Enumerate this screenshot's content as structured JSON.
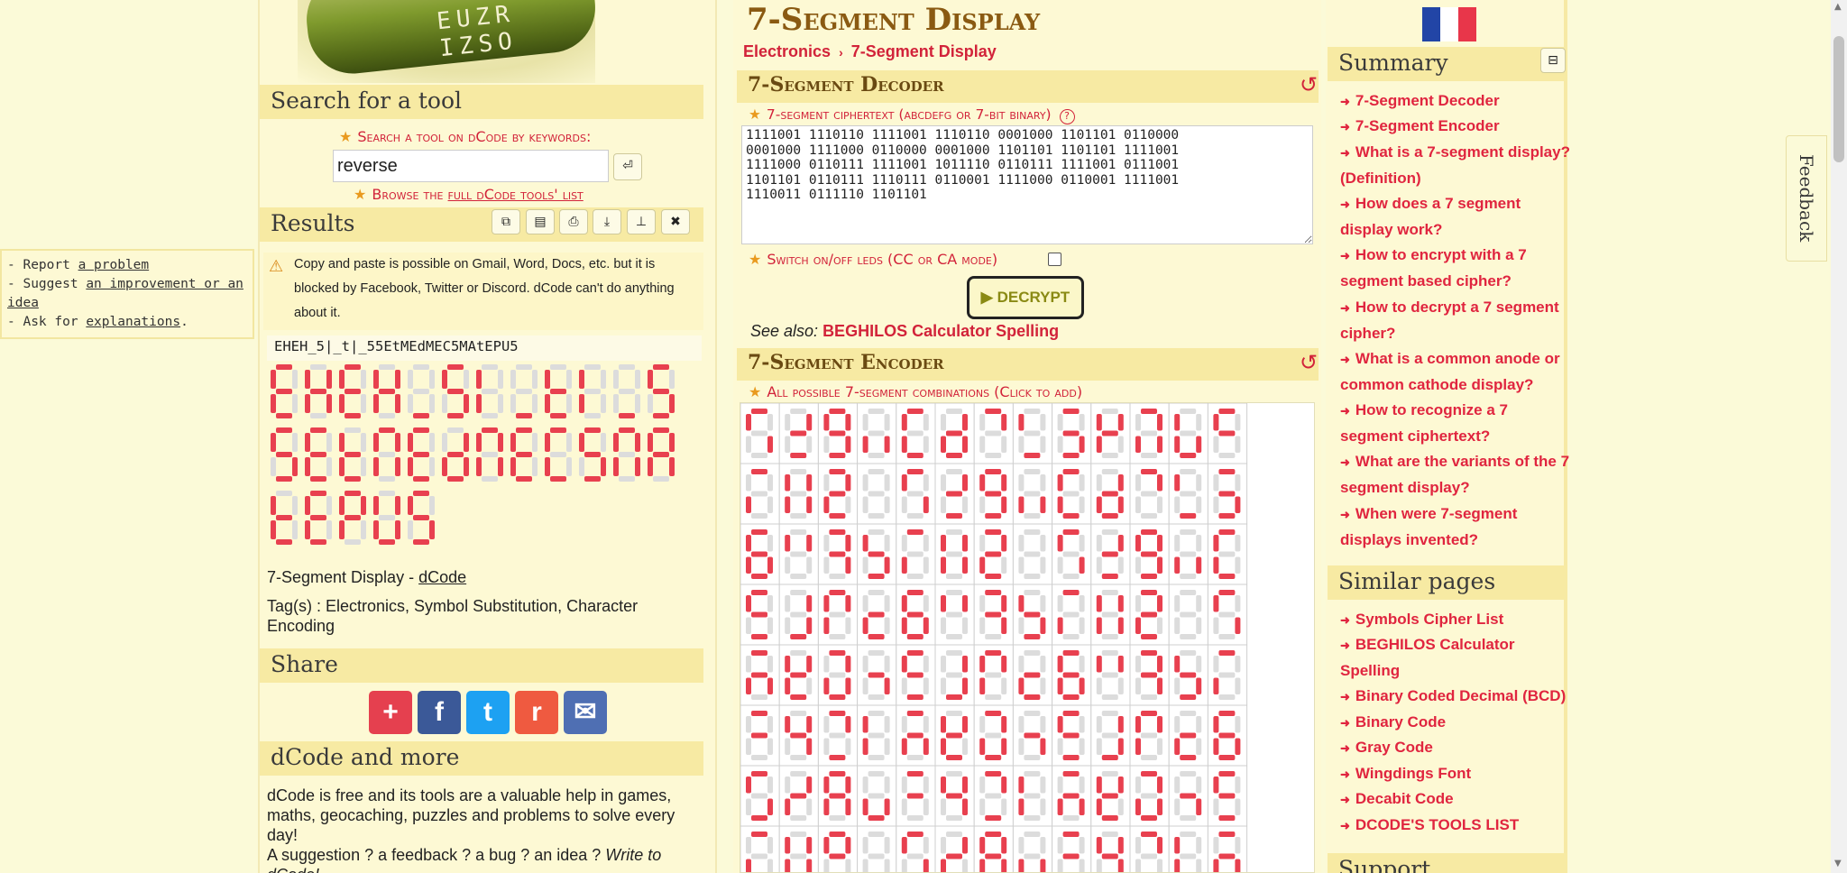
{
  "banner": {
    "letters": "EUZR IZSO"
  },
  "page": {
    "title": "7-Segment Display",
    "flag": "french-flag"
  },
  "breadcrumb": {
    "items": [
      "Electronics",
      "7-Segment Display"
    ],
    "sep": "›"
  },
  "search": {
    "title": "Search for a tool",
    "label": "Search a tool on dCode by keywords:",
    "value": "reverse",
    "enter_icon": "⏎",
    "browse_prefix": "Browse the ",
    "browse_link": "full dCode tools' list"
  },
  "results": {
    "title": "Results",
    "toolbar": [
      "copy-icon",
      "save-icon",
      "print-icon",
      "download-icon",
      "pin-icon",
      "close-icon"
    ],
    "warning": "Copy and paste is possible on Gmail, Word, Docs, etc. but it is blocked by Facebook, Twitter or Discord. dCode can't do anything about it.",
    "text": "EHEH_5|_t|_55EtMEdMEC5MAtEPU5",
    "display_rows": [
      [
        "E",
        "H",
        "E",
        "H",
        "_",
        "5",
        "I",
        "_",
        "t",
        "I",
        "_",
        "5"
      ],
      [
        "5",
        "E",
        "t",
        "M",
        "E",
        "d",
        "M",
        "E",
        "C",
        "5",
        "M",
        "A"
      ],
      [
        "t",
        "E",
        "P",
        "U",
        "5"
      ]
    ],
    "attribution_text": "7-Segment Display - ",
    "attribution_link": "dCode",
    "tags": "Tag(s) : Electronics, Symbol Substitution, Character Encoding"
  },
  "report": {
    "line1_prefix": "- Report ",
    "line1_link": "a problem",
    "line2_prefix": "- Suggest ",
    "line2_link": "an improvement or an idea",
    "line3_prefix": "- Ask for ",
    "line3_link": "explanations",
    "line3_suffix": "."
  },
  "share": {
    "title": "Share",
    "buttons": [
      {
        "icon": "plus-icon",
        "glyph": "+",
        "color": "#e5404f"
      },
      {
        "icon": "facebook-icon",
        "glyph": "f",
        "color": "#3b5998"
      },
      {
        "icon": "twitter-icon",
        "glyph": "t",
        "color": "#1da1f2"
      },
      {
        "icon": "reddit-icon",
        "glyph": "r",
        "color": "#ef5a40"
      },
      {
        "icon": "mail-icon",
        "glyph": "✉",
        "color": "#4f6fb3"
      }
    ]
  },
  "more": {
    "title": "dCode and more",
    "text": "dCode is free and its tools are a valuable help in games, maths, geocaching, puzzles and problems to solve every day!",
    "text2_prefix": "A suggestion ? a feedback ? a bug ? an idea ? ",
    "text2_link": "Write to dCode!"
  },
  "decoder": {
    "title": "7-Segment Decoder",
    "reset_icon": "↺",
    "field_label": "7-segment ciphertext (abcdefg or 7-bit binary)",
    "help_icon": "?",
    "ciphertext": "1111001 1110110 1111001 1110110 0001000 1101101 0110000\n0001000 1111000 0110000 0001000 1101101 1101101 1111001\n1111000 0110111 1111001 1011110 0110111 1111001 0111001\n1101101 0110111 1110111 0110001 1111000 0110001 1111001\n1110011 0111110 1101101",
    "switch_label": "Switch on/off leds (CC or CA mode)",
    "decrypt_label": "▶ DECRYPT",
    "see_also_label": "See also: ",
    "see_also_link": "BEGHILOS Calculator Spelling"
  },
  "encoder": {
    "title": "7-Segment Encoder",
    "reset_icon": "↺",
    "field_label": "All possible 7-segment combinations (Click to add)"
  },
  "summary": {
    "title": "Summary",
    "collapse_icon": "⊟",
    "items": [
      "7-Segment Decoder",
      "7-Segment Encoder",
      "What is a 7-segment display? (Definition)",
      "How does a 7 segment display work?",
      "How to encrypt with a 7 segment based cipher?",
      "How to decrypt a 7 segment cipher?",
      "What is a common anode or common cathode display?",
      "How to recognize a 7 segment ciphertext?",
      "What are the variants of the 7 segment display?",
      "When were 7-segment displays invented?"
    ]
  },
  "similar": {
    "title": "Similar pages",
    "items": [
      "Symbols Cipher List",
      "BEGHILOS Calculator Spelling",
      "Binary Coded Decimal (BCD)",
      "Binary Code",
      "Gray Code",
      "Wingdings Font",
      "Decabit Code",
      "DCODE'S TOOLS LIST"
    ]
  },
  "support": {
    "title": "Support"
  },
  "feedback": {
    "label": "Feedback"
  },
  "colors": {
    "accent": "#d2233a",
    "segment_on": "#e8404f",
    "segment_off": "#dcdcdc",
    "header_bg": "#f7eaa3"
  }
}
